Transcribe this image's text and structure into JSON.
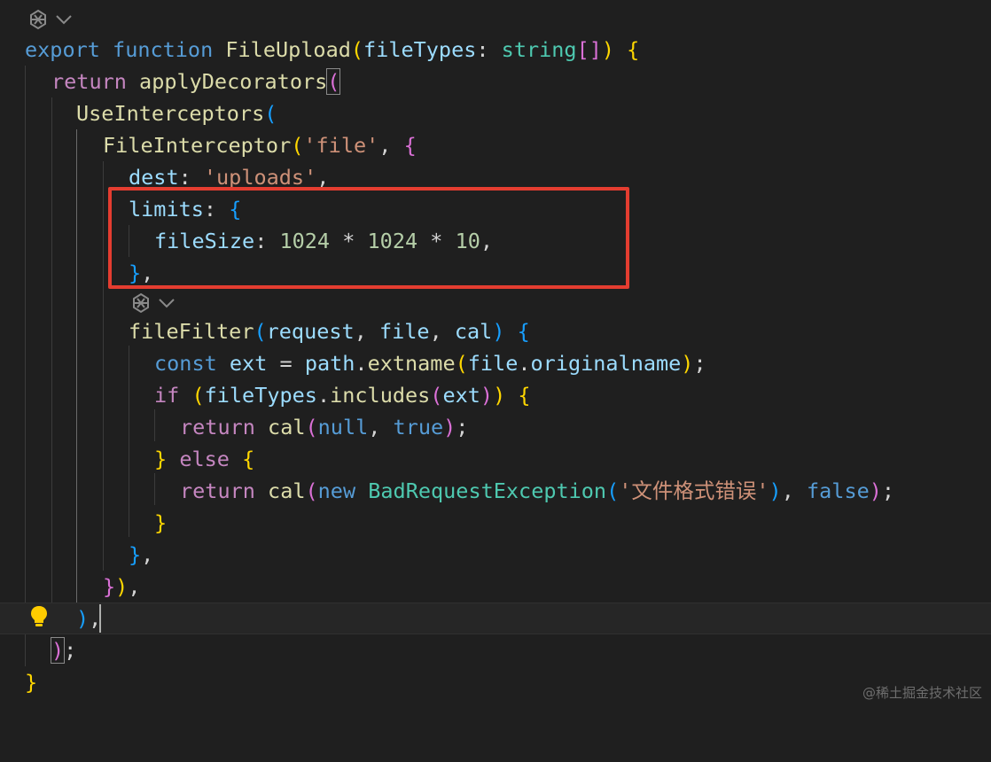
{
  "editor": {
    "lens_icon": "openai-sparkle-icon",
    "lens_chevron": "chevron-down-icon",
    "lines": {
      "l1": [
        "export",
        "function",
        "FileUpload",
        "(",
        "fileTypes",
        ": ",
        "string",
        "[]",
        ")",
        " {"
      ],
      "l2": [
        "return",
        "applyDecorators",
        "("
      ],
      "l3": [
        "UseInterceptors",
        "("
      ],
      "l4": [
        "FileInterceptor",
        "(",
        "'file'",
        ", ",
        "{"
      ],
      "l5": [
        "dest",
        ": ",
        "'uploads'",
        ","
      ],
      "l6": [
        "limits",
        ": ",
        "{"
      ],
      "l7": [
        "fileSize",
        ": ",
        "1024",
        " * ",
        "1024",
        " * ",
        "10",
        ","
      ],
      "l8": [
        "}",
        ","
      ],
      "l9": [
        "fileFilter",
        "(",
        "request",
        ", ",
        "file",
        ", ",
        "cal",
        ")",
        " {"
      ],
      "l10": [
        "const",
        " ",
        "ext",
        " = ",
        "path",
        ".",
        "extname",
        "(",
        "file",
        ".",
        "originalname",
        ")",
        ";"
      ],
      "l11": [
        "if",
        " ",
        "(",
        "fileTypes",
        ".",
        "includes",
        "(",
        "ext",
        ")",
        ")",
        " {"
      ],
      "l12": [
        "return",
        " ",
        "cal",
        "(",
        "null",
        ", ",
        "true",
        ")",
        ";"
      ],
      "l13": [
        "}",
        " ",
        "else",
        " ",
        "{"
      ],
      "l14": [
        "return",
        " ",
        "cal",
        "(",
        "new",
        " ",
        "BadRequestException",
        "(",
        "'文件格式错误'",
        ")",
        ", ",
        "false",
        ")",
        ";"
      ],
      "l15": [
        "}"
      ],
      "l16": [
        "}",
        ","
      ],
      "l17": [
        "}",
        ")",
        ","
      ],
      "l18": [
        ")",
        ","
      ],
      "l19": [
        ")",
        ";"
      ],
      "l20": [
        "}"
      ]
    }
  },
  "watermark": "@稀土掘金技术社区",
  "colors": {
    "background": "#1f1f1f",
    "highlight_box": "#e43d30",
    "keyword_blue": "#569cd6",
    "keyword_purple": "#c586c0",
    "function_yellow": "#dcdcaa",
    "type_teal": "#4ec9b0",
    "variable_lightblue": "#9cdcfe",
    "string_orange": "#ce9178",
    "number_green": "#b5cea8",
    "bracket_gold": "#ffd700",
    "bracket_orchid": "#da70d6",
    "bracket_blue": "#179fff"
  }
}
